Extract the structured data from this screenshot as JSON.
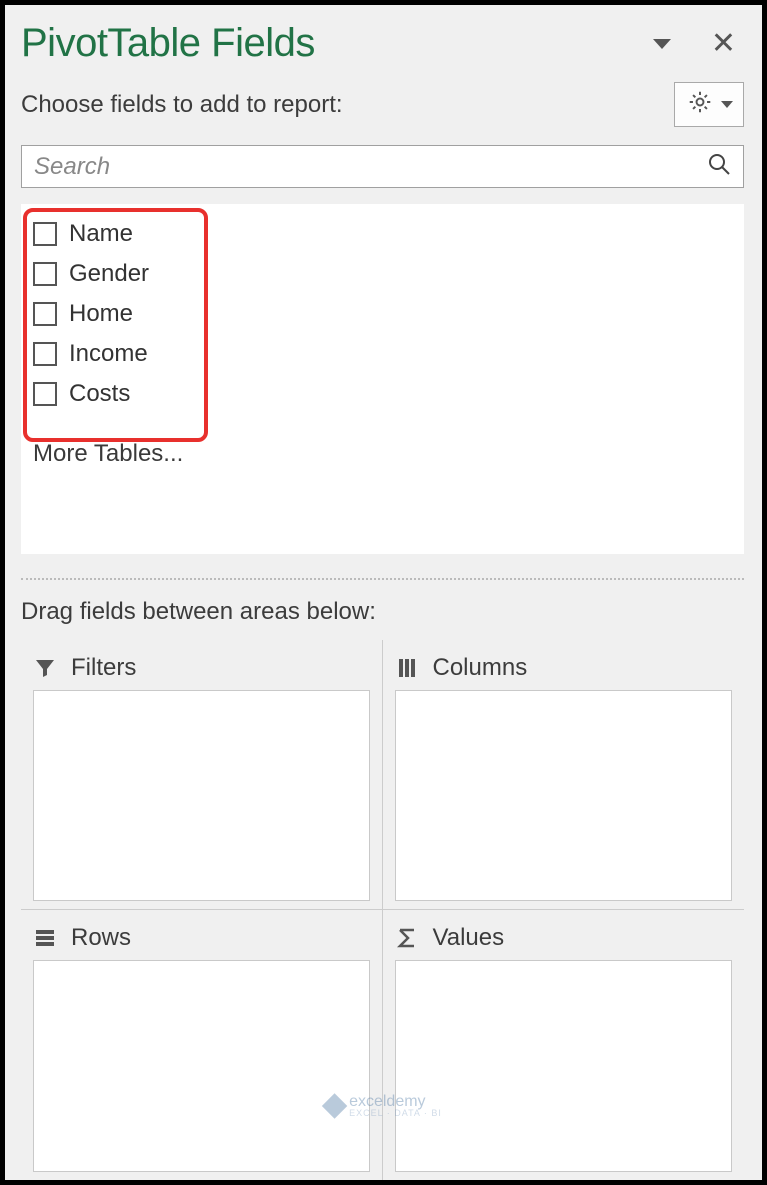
{
  "header": {
    "title": "PivotTable Fields"
  },
  "instruction": "Choose fields to add to report:",
  "search": {
    "placeholder": "Search"
  },
  "fields": [
    {
      "label": "Name"
    },
    {
      "label": "Gender"
    },
    {
      "label": "Home"
    },
    {
      "label": "Income"
    },
    {
      "label": "Costs"
    }
  ],
  "more_tables_label": "More Tables...",
  "drag_instruction": "Drag fields between areas below:",
  "areas": {
    "filters": "Filters",
    "columns": "Columns",
    "rows": "Rows",
    "values": "Values"
  },
  "watermark": {
    "brand": "exceldemy",
    "sub": "EXCEL · DATA · BI"
  }
}
